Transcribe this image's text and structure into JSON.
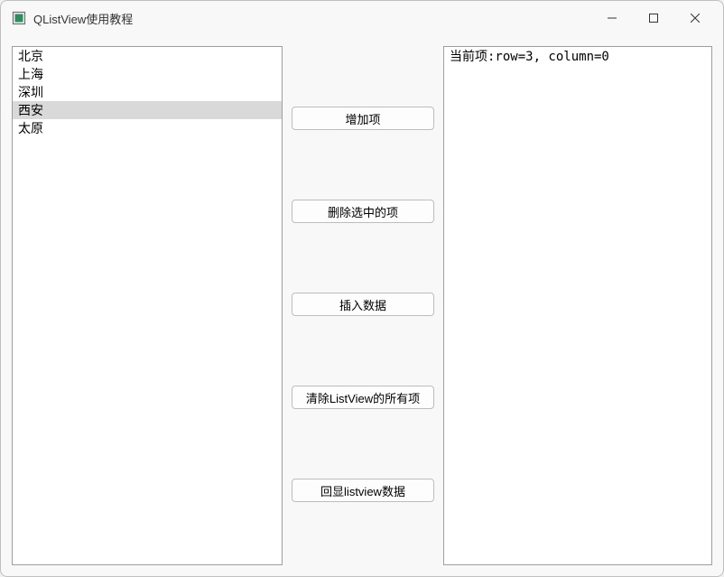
{
  "window": {
    "title": "QListView使用教程"
  },
  "list": {
    "items": [
      "北京",
      "上海",
      "深圳",
      "西安",
      "太原"
    ],
    "selected_index": 3
  },
  "buttons": {
    "add": "增加项",
    "delete_selected": "删除选中的项",
    "insert": "插入数据",
    "clear_all": "清除ListView的所有项",
    "echo": "回显listview数据"
  },
  "output": {
    "text": "当前项:row=3, column=0"
  }
}
